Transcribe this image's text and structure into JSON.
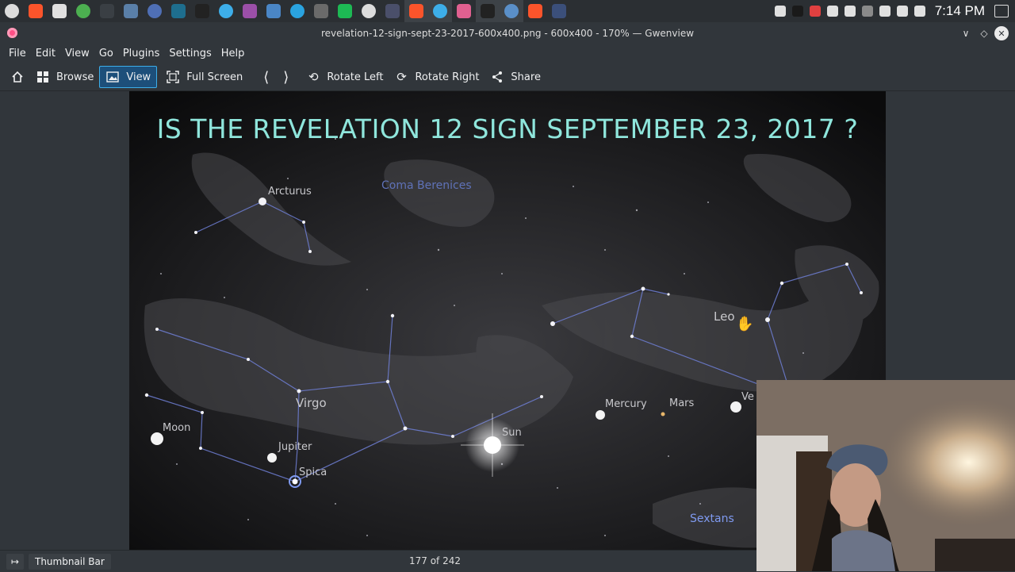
{
  "taskbar": {
    "apps": [
      {
        "name": "launcher-icon",
        "color": "#dcdcdc"
      },
      {
        "name": "brave-icon",
        "color": "#fb542b"
      },
      {
        "name": "settings-icon",
        "color": "#e0e0e0"
      },
      {
        "name": "chrome-icon",
        "color": "#4caf50"
      },
      {
        "name": "terminal-icon",
        "color": "#3a3f44"
      },
      {
        "name": "network-icon",
        "color": "#5a7fa8"
      },
      {
        "name": "document-viewer-icon",
        "color": "#4f6fb5"
      },
      {
        "name": "panel-icon",
        "color": "#1e6e8e"
      },
      {
        "name": "obs-icon",
        "color": "#222222"
      },
      {
        "name": "file-manager-icon",
        "color": "#3daee9"
      },
      {
        "name": "video-editor-icon",
        "color": "#9b4fa8"
      },
      {
        "name": "image-editor-icon",
        "color": "#4a86c6"
      },
      {
        "name": "telegram-icon",
        "color": "#2aa3df"
      },
      {
        "name": "text-editor-icon",
        "color": "#6a6a6a"
      },
      {
        "name": "spotify-icon",
        "color": "#1db954"
      },
      {
        "name": "night-mode-icon",
        "color": "#dcdcdc"
      },
      {
        "name": "circle-app-icon",
        "color": "#4a4f6a"
      },
      {
        "name": "brave-window-icon",
        "color": "#fb542b"
      },
      {
        "name": "folder-window-icon",
        "color": "#3daee9"
      },
      {
        "name": "plant-app-icon",
        "color": "#e06090"
      },
      {
        "name": "obs-window-icon",
        "color": "#222222"
      },
      {
        "name": "gwenview-window-icon",
        "color": "#5a8fc8"
      },
      {
        "name": "brave-window-2-icon",
        "color": "#fb542b"
      },
      {
        "name": "app-window-icon",
        "color": "#3b4f7a"
      }
    ],
    "tray": [
      {
        "name": "media-play-icon",
        "color": "#e0e0e0"
      },
      {
        "name": "obs-tray-icon",
        "color": "#1a1a1a"
      },
      {
        "name": "screenshot-tray-icon",
        "color": "#e04040"
      },
      {
        "name": "updates-tray-icon",
        "color": "#e0e0e0"
      },
      {
        "name": "clipboard-tray-icon",
        "color": "#e0e0e0"
      },
      {
        "name": "keyboard-tray-icon",
        "color": "#8a8a8a"
      },
      {
        "name": "wifi-icon",
        "color": "#e0e0e0"
      },
      {
        "name": "battery-icon",
        "color": "#e0e0e0"
      },
      {
        "name": "tray-expand-icon",
        "color": "#e0e0e0"
      }
    ],
    "clock": "7:14 PM"
  },
  "window": {
    "title": "revelation-12-sign-sept-23-2017-600x400.png - 600x400 - 170% — Gwenview"
  },
  "menu": [
    "File",
    "Edit",
    "View",
    "Go",
    "Plugins",
    "Settings",
    "Help"
  ],
  "toolbar": {
    "browse": "Browse",
    "view": "View",
    "full_screen": "Full Screen",
    "rotate_left": "Rotate Left",
    "rotate_right": "Rotate Right",
    "share": "Share"
  },
  "image": {
    "title": "IS THE REVELATION 12 SIGN SEPTEMBER 23, 2017 ?",
    "labels": {
      "arcturus": "Arcturus",
      "coma": "Coma Berenices",
      "leo": "Leo",
      "virgo": "Virgo",
      "moon": "Moon",
      "jupiter": "Jupiter",
      "spica": "Spica",
      "sun": "Sun",
      "mercury": "Mercury",
      "mars": "Mars",
      "venus": "Ve",
      "sextans": "Sextans"
    }
  },
  "statusbar": {
    "thumbnail_bar": "Thumbnail Bar",
    "position": "177 of 242"
  }
}
